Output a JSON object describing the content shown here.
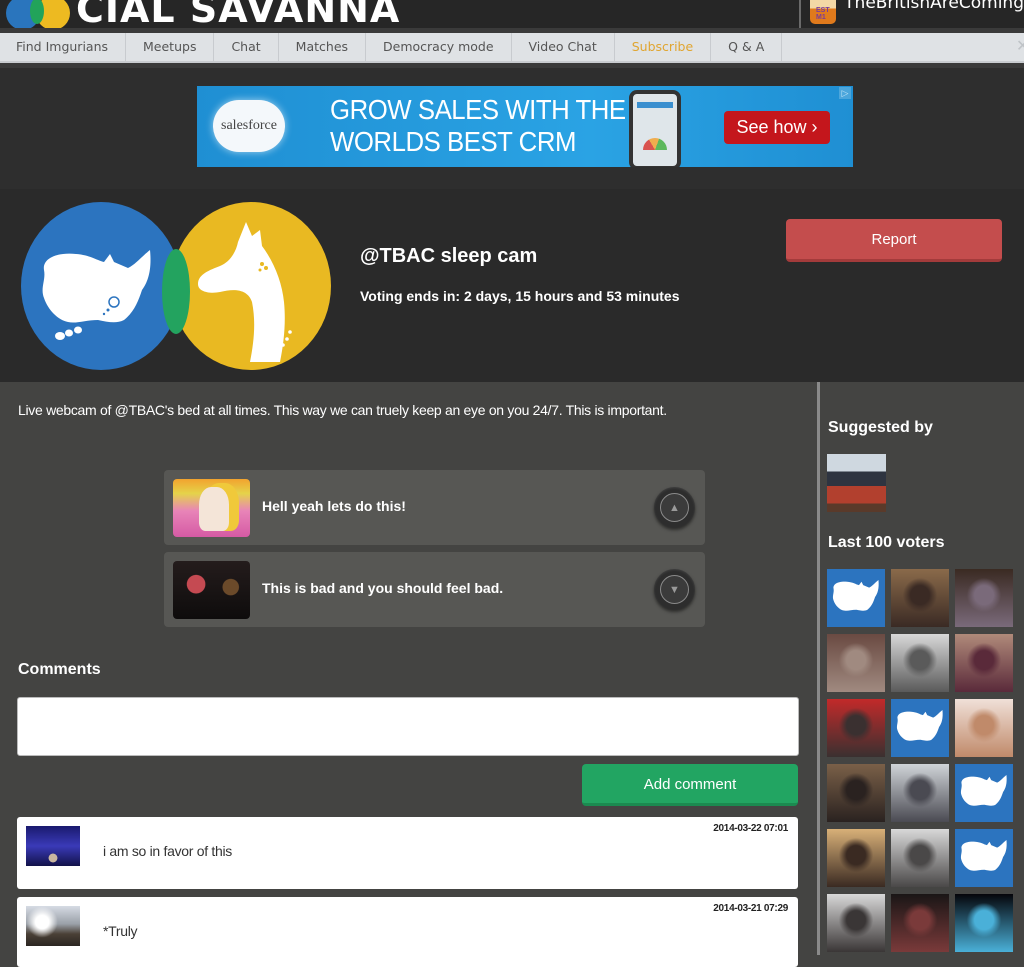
{
  "header": {
    "logo_text": "CIAL SAVANNA",
    "logo_name": "Social Savanna",
    "user": {
      "name": "TheBritishAreComing",
      "avatar_label": "EST M1"
    }
  },
  "nav": {
    "items": [
      {
        "label": "Find Imgurians"
      },
      {
        "label": "Meetups"
      },
      {
        "label": "Chat"
      },
      {
        "label": "Matches"
      },
      {
        "label": "Democracy mode"
      },
      {
        "label": "Video Chat"
      },
      {
        "label": "Subscribe",
        "highlight_color": "#e0a530"
      },
      {
        "label": "Q & A"
      }
    ],
    "close_icon": "x-icon"
  },
  "ad": {
    "brand": "salesforce",
    "headline_line1": "GROW SALES WITH THE",
    "headline_line2": "WORLDS BEST CRM",
    "cta": "See how ›",
    "adchoices_icon": "▷"
  },
  "topic": {
    "title": "@TBAC sleep cam",
    "voting": "Voting ends in: 2 days, 15 hours and 53 minutes",
    "report_label": "Report",
    "description": "Live webcam of @TBAC's bed at all times. This way we can truely keep an eye on you 24/7. This is important."
  },
  "votes": {
    "yes": {
      "label": "Hell yeah lets do this!",
      "icon": "▲"
    },
    "no": {
      "label": "This is bad and you should feel bad.",
      "icon": "▼"
    }
  },
  "comments": {
    "heading": "Comments",
    "input_value": "",
    "input_placeholder": "",
    "add_label": "Add comment",
    "items": [
      {
        "text": "i am so in favor of this",
        "date": "2014-03-22 07:01"
      },
      {
        "text": "*Truly",
        "date": "2014-03-21 07:29"
      }
    ]
  },
  "sidebar": {
    "suggested_heading": "Suggested by",
    "voters_heading": "Last 100 voters",
    "voters": [
      {
        "type": "rhino"
      },
      {
        "type": "photo",
        "colors": [
          "#8a6a4a",
          "#3a2a24"
        ]
      },
      {
        "type": "photo",
        "colors": [
          "#3a2a22",
          "#7a6a7a"
        ]
      },
      {
        "type": "photo",
        "colors": [
          "#6a4a42",
          "#a08a80"
        ]
      },
      {
        "type": "photo",
        "colors": [
          "#d8d8d8",
          "#5a5a5a"
        ]
      },
      {
        "type": "photo",
        "colors": [
          "#b08a7a",
          "#5a2a3a"
        ]
      },
      {
        "type": "photo",
        "colors": [
          "#c22a2a",
          "#3a3030"
        ]
      },
      {
        "type": "rhino"
      },
      {
        "type": "photo",
        "colors": [
          "#f0e0d8",
          "#c08a6a"
        ]
      },
      {
        "type": "photo",
        "colors": [
          "#7a6048",
          "#2a2220"
        ]
      },
      {
        "type": "photo",
        "colors": [
          "#d0d4d8",
          "#4a4a52"
        ]
      },
      {
        "type": "rhino"
      },
      {
        "type": "photo",
        "colors": [
          "#d8b078",
          "#3a2a22"
        ]
      },
      {
        "type": "photo",
        "colors": [
          "#d8d8d8",
          "#4a4848"
        ]
      },
      {
        "type": "rhino"
      },
      {
        "type": "photo",
        "colors": [
          "#d8d8d8",
          "#3a3636"
        ]
      },
      {
        "type": "photo",
        "colors": [
          "#1a1616",
          "#7a3a3a"
        ]
      },
      {
        "type": "photo",
        "colors": [
          "#05050a",
          "#4ab0d8"
        ]
      }
    ]
  },
  "colors": {
    "report": "#c44d4d",
    "add_comment": "#22a562",
    "logo_blue": "#2c74bf",
    "logo_yellow": "#e9b922",
    "logo_green": "#23a35f"
  }
}
